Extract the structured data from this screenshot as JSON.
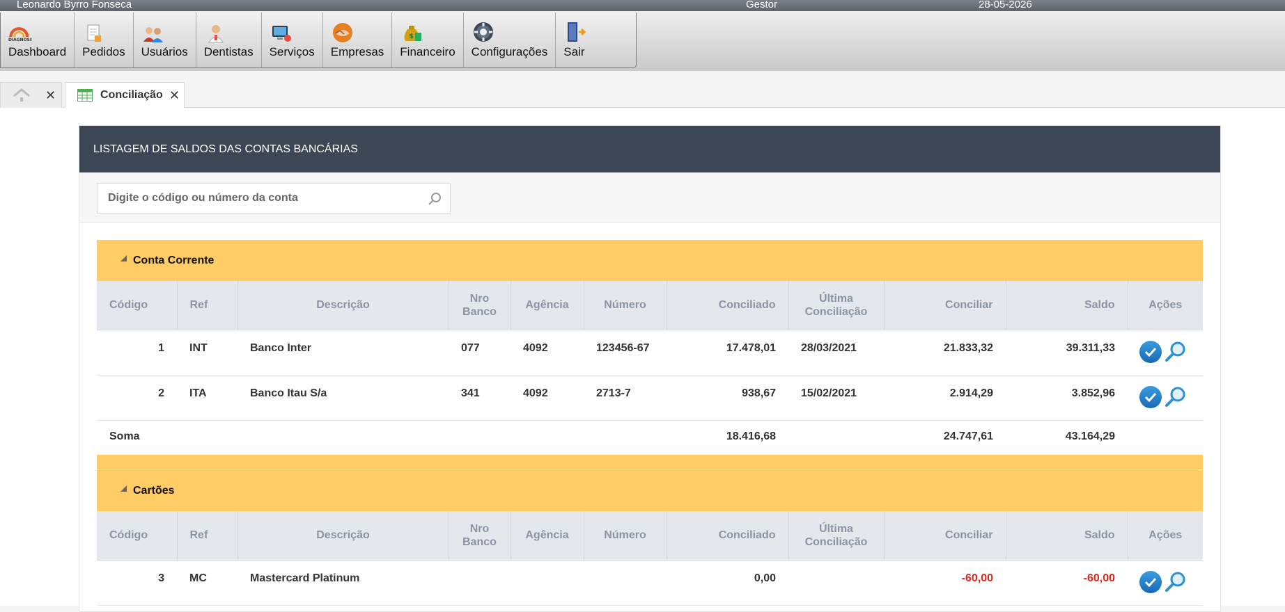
{
  "userbar": {
    "user": "Leonardo Byrro Fonseca",
    "role": "Gestor",
    "date": "28-05-2026"
  },
  "menu": [
    {
      "label": "Dashboard",
      "icon": "diagnosis-logo-icon"
    },
    {
      "label": "Pedidos",
      "icon": "document-icon"
    },
    {
      "label": "Usuários",
      "icon": "users-icon"
    },
    {
      "label": "Dentistas",
      "icon": "dentist-icon"
    },
    {
      "label": "Serviços",
      "icon": "services-icon"
    },
    {
      "label": "Empresas",
      "icon": "handshake-icon"
    },
    {
      "label": "Financeiro",
      "icon": "money-bag-icon"
    },
    {
      "label": "Configurações",
      "icon": "gear-icon"
    },
    {
      "label": "Sair",
      "icon": "exit-door-icon"
    }
  ],
  "tabs": {
    "active_label": "Conciliação"
  },
  "panel": {
    "title": "LISTAGEM DE SALDOS DAS CONTAS BANCÁRIAS",
    "search_placeholder": "Digite o código ou número da conta"
  },
  "columns": {
    "codigo": "Código",
    "ref": "Ref",
    "descricao": "Descrição",
    "nro_banco_1": "Nro",
    "nro_banco_2": "Banco",
    "agencia": "Agência",
    "numero": "Número",
    "conciliado": "Conciliado",
    "ultima_1": "Última",
    "ultima_2": "Conciliação",
    "conciliar": "Conciliar",
    "saldo": "Saldo",
    "acoes": "Ações"
  },
  "groups": {
    "corrente": {
      "title": "Conta Corrente",
      "rows": [
        {
          "codigo": "1",
          "ref": "INT",
          "descricao": "Banco Inter",
          "banco": "077",
          "agencia": "4092",
          "numero": "123456-67",
          "conciliado": "17.478,01",
          "ultima": "28/03/2021",
          "conciliar": "21.833,32",
          "saldo": "39.311,33"
        },
        {
          "codigo": "2",
          "ref": "ITA",
          "descricao": "Banco Itau S/a",
          "banco": "341",
          "agencia": "4092",
          "numero": "2713-7",
          "conciliado": "938,67",
          "ultima": "15/02/2021",
          "conciliar": "2.914,29",
          "saldo": "3.852,96"
        }
      ],
      "sum": {
        "label": "Soma",
        "conciliado": "18.416,68",
        "conciliar": "24.747,61",
        "saldo": "43.164,29"
      }
    },
    "cartoes": {
      "title": "Cartões",
      "rows": [
        {
          "codigo": "3",
          "ref": "MC",
          "descricao": "Mastercard Platinum",
          "banco": "",
          "agencia": "",
          "numero": "",
          "conciliado": "0,00",
          "ultima": "",
          "conciliar": "-60,00",
          "saldo": "-60,00"
        }
      ]
    }
  },
  "colors": {
    "header_dark": "#3d4654",
    "group_band": "#ffcc66",
    "negative": "#e0261d",
    "action_blue": "#1e7fd0"
  }
}
